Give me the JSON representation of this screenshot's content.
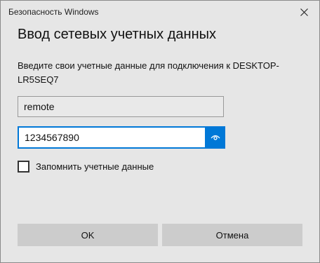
{
  "window": {
    "title": "Безопасность Windows",
    "close_icon": "close-icon"
  },
  "dialog": {
    "heading": "Ввод сетевых учетных данных",
    "description": "Введите свои учетные данные для подключения к DESKTOP-LR5SEQ7"
  },
  "form": {
    "username_value": "remote",
    "password_value": "1234567890",
    "reveal_icon": "eye-icon",
    "remember_label": "Запомнить учетные данные",
    "remember_checked": false
  },
  "buttons": {
    "ok_label": "OK",
    "cancel_label": "Отмена"
  },
  "colors": {
    "accent": "#0078d7",
    "background": "#e6e6e6",
    "button": "#cccccc"
  }
}
